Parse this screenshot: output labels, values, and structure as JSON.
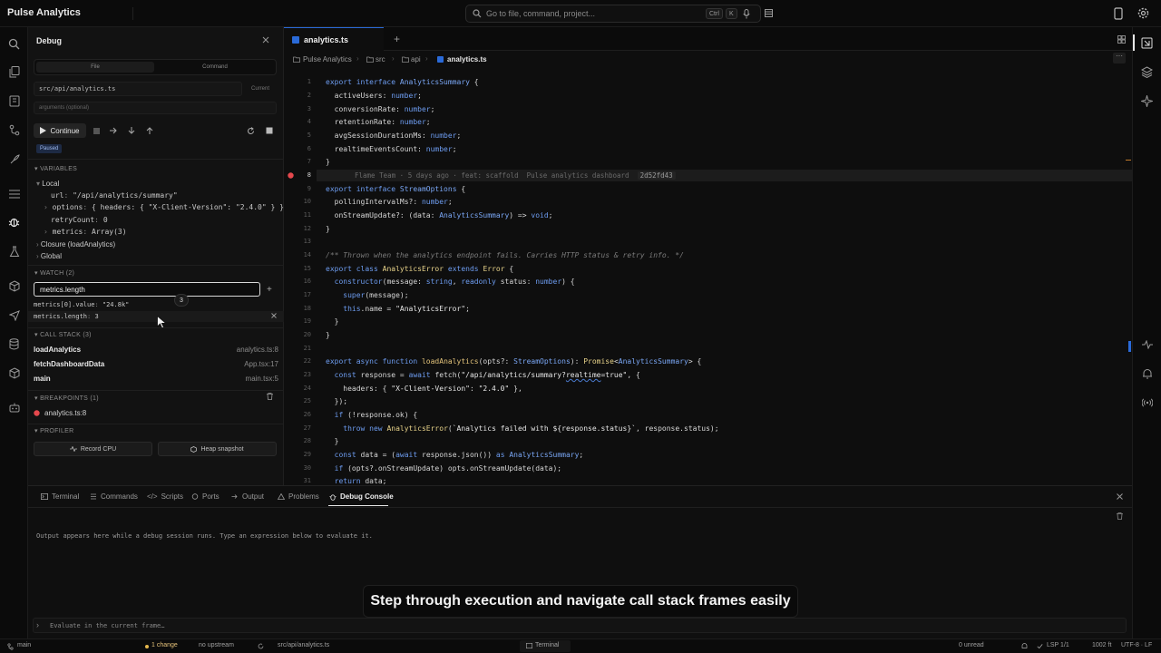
{
  "app": {
    "title": "Pulse Analytics"
  },
  "search": {
    "placeholder": "Go to file, command, project...",
    "kbd1": "Ctrl",
    "kbd2": "K"
  },
  "debug": {
    "title": "Debug",
    "mode_tabs": [
      "File",
      "Command"
    ],
    "file_path": "src/api/analytics.ts",
    "current_label": "Current",
    "args_placeholder": "arguments (optional)",
    "continue_label": "Continue",
    "paused_label": "Paused",
    "variables_header": "VARIABLES",
    "scopes": {
      "local": "Local",
      "closure": "Closure (loadAnalytics)",
      "global": "Global"
    },
    "vars": [
      {
        "name": "url",
        "value": "\"/api/analytics/summary\""
      },
      {
        "name": "options",
        "value": "{ headers: { \"X-Client-Version\": \"2.4.0\" } }"
      },
      {
        "name": "retryCount",
        "value": "0"
      },
      {
        "name": "metrics",
        "value": "Array(3)"
      }
    ],
    "watch_header": "WATCH (2)",
    "watch_input": "metrics.length",
    "watch_tooltip": "3",
    "watch_items": [
      {
        "expr": "metrics[0].value",
        "value": "\"24.8k\""
      },
      {
        "expr": "metrics.length",
        "value": "3"
      }
    ],
    "callstack_header": "CALL STACK (3)",
    "callstack": [
      {
        "fn": "loadAnalytics",
        "loc": "analytics.ts:8"
      },
      {
        "fn": "fetchDashboardData",
        "loc": "App.tsx:17"
      },
      {
        "fn": "main",
        "loc": "main.tsx:5"
      }
    ],
    "breakpoints_header": "BREAKPOINTS (1)",
    "breakpoint": "analytics.ts:8",
    "profiler_header": "PROFILER",
    "record_cpu": "Record CPU",
    "heap_snapshot": "Heap snapshot"
  },
  "editor": {
    "tab_label": "analytics.ts",
    "breadcrumb": [
      "Pulse Analytics",
      "src",
      "api",
      "analytics.ts"
    ],
    "blame": "Flame Team · 5 days ago · feat: scaffold  Pulse analytics dashboard",
    "blame_hash": "2d52fd43",
    "line_numbers": [
      "1",
      "2",
      "3",
      "4",
      "5",
      "6",
      "7",
      "8",
      "9",
      "10",
      "11",
      "12",
      "13",
      "14",
      "15",
      "16",
      "17",
      "18",
      "19",
      "20",
      "21",
      "22",
      "23",
      "24",
      "25",
      "26",
      "27",
      "28",
      "29",
      "30",
      "31"
    ]
  },
  "panel": {
    "tabs": [
      "Terminal",
      "Commands",
      "Scripts",
      "Ports",
      "Output",
      "Problems",
      "Debug Console"
    ],
    "message": "Output appears here while a debug session runs. Type an expression below to evaluate it.",
    "eval_placeholder": "Evaluate in the current frame…"
  },
  "caption": "Step through execution and navigate call stack frames easily",
  "status": {
    "branch": "main",
    "changes": "1 change",
    "upstream": "no upstream",
    "file": "src/api/analytics.ts",
    "terminal": "Terminal",
    "unread": "0 unread",
    "lsp": "LSP 1/1",
    "position": "1002 ft",
    "encoding": "UTF-8 · LF"
  },
  "colors": {
    "accent": "#2a6ad8",
    "breakpoint": "#e5484d",
    "keyword": "#6d9cf0",
    "type": "#e8d38a"
  }
}
